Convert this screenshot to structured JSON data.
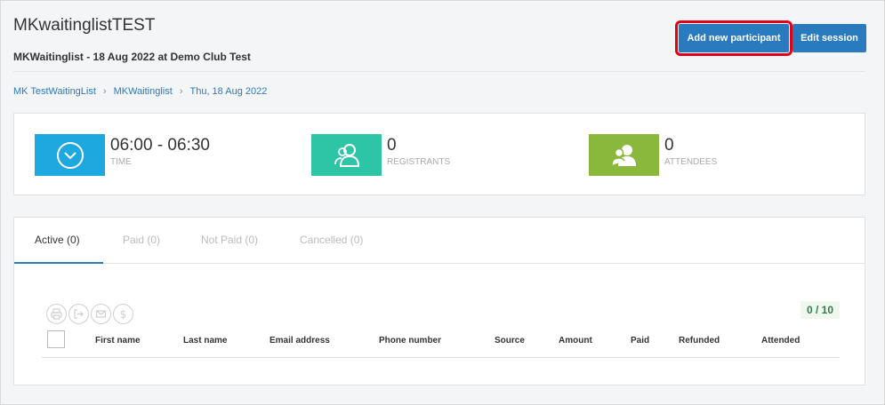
{
  "header": {
    "title": "MKwaitinglistTEST",
    "subtitle": "MKWaitinglist - 18 Aug 2022 at Demo Club Test",
    "add_participant_label": "Add new participant",
    "edit_session_label": "Edit session"
  },
  "breadcrumb": {
    "items": [
      "MK TestWaitingList",
      "MKWaitinglist",
      "Thu, 18 Aug 2022"
    ],
    "separator": "›"
  },
  "stats": {
    "time": {
      "value": "06:00 - 06:30",
      "label": "TIME",
      "color": "#1ea8e0",
      "icon": "clock-icon"
    },
    "registrants": {
      "value": "0",
      "label": "REGISTRANTS",
      "color": "#2ec4a6",
      "icon": "users-icon"
    },
    "attendees": {
      "value": "0",
      "label": "ATTENDEES",
      "color": "#8ab83c",
      "icon": "attendees-icon"
    }
  },
  "tabs": [
    {
      "label": "Active (0)",
      "active": true
    },
    {
      "label": "Paid (0)",
      "active": false
    },
    {
      "label": "Not Paid (0)",
      "active": false
    },
    {
      "label": "Cancelled (0)",
      "active": false
    }
  ],
  "toolbar": {
    "icons": [
      "print-icon",
      "export-icon",
      "email-icon",
      "dollar-icon"
    ],
    "counter": "0 / 10"
  },
  "table": {
    "columns": [
      "First name",
      "Last name",
      "Email address",
      "Phone number",
      "Source",
      "Amount",
      "Paid",
      "Refunded",
      "Attended"
    ]
  },
  "colors": {
    "accent": "#2a7ac0",
    "highlight": "#e0001a"
  }
}
